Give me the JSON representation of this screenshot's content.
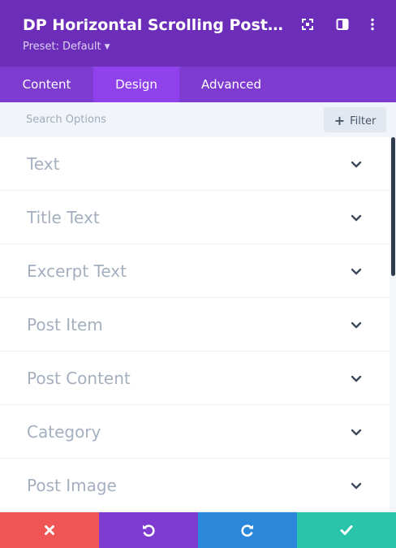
{
  "header": {
    "title": "DP Horizontal Scrolling Posts Set...",
    "preset_label": "Preset: Default",
    "background": "#6c2eb9"
  },
  "header_icons": [
    "expand-icon",
    "sidebar-toggle-icon",
    "more-vertical-icon"
  ],
  "tabs": [
    {
      "label": "Content",
      "active": false
    },
    {
      "label": "Design",
      "active": true
    },
    {
      "label": "Advanced",
      "active": false
    }
  ],
  "search": {
    "placeholder": "Search Options",
    "filter_label": "Filter"
  },
  "sections": [
    {
      "label": "Text"
    },
    {
      "label": "Title Text"
    },
    {
      "label": "Excerpt Text"
    },
    {
      "label": "Post Item"
    },
    {
      "label": "Post Content"
    },
    {
      "label": "Category"
    },
    {
      "label": "Post Image"
    }
  ],
  "footer": [
    {
      "action": "discard",
      "icon": "close-icon",
      "color": "#ef5555"
    },
    {
      "action": "undo",
      "icon": "undo-icon",
      "color": "#7e3bd0"
    },
    {
      "action": "redo",
      "icon": "redo-icon",
      "color": "#2b87da"
    },
    {
      "action": "save",
      "icon": "check-icon",
      "color": "#29c4a9"
    }
  ]
}
